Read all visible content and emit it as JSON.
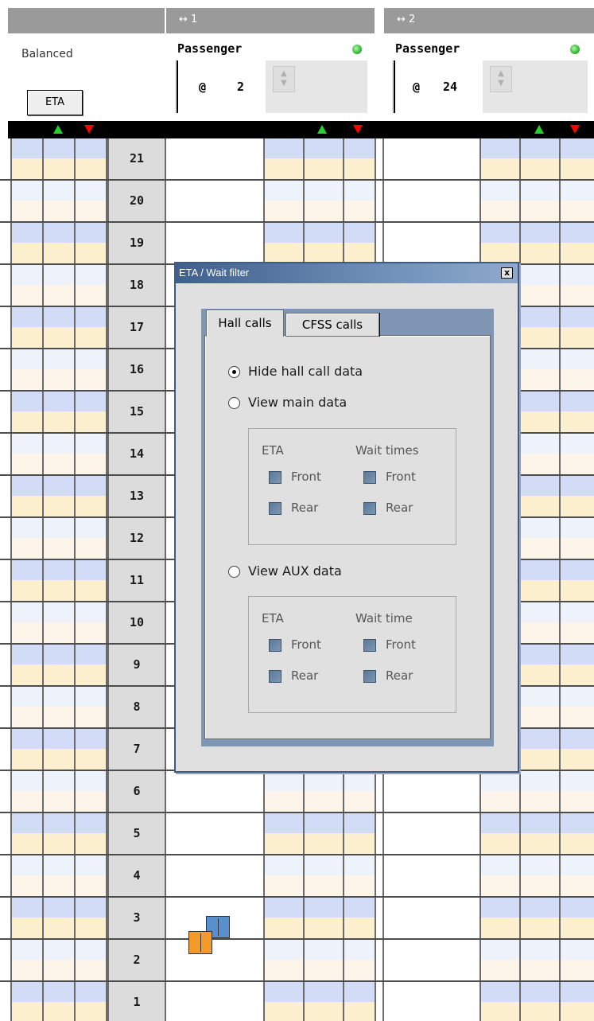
{
  "header": {
    "mode_label": "Balanced",
    "eta_button": "ETA",
    "groups": [
      {
        "label": "↔ 1",
        "car_type": "Passenger",
        "position_prefix": "@",
        "position": "2",
        "status_color": "#3bbf3b"
      },
      {
        "label": "↔ 2",
        "car_type": "Passenger",
        "position_prefix": "@",
        "position": "24",
        "status_color": "#3bbf3b"
      }
    ]
  },
  "floors": [
    "21",
    "20",
    "19",
    "18",
    "17",
    "16",
    "15",
    "14",
    "13",
    "12",
    "11",
    "10",
    "9",
    "8",
    "7",
    "6",
    "5",
    "4",
    "3",
    "2",
    "1"
  ],
  "cars_at_floor": "2",
  "dialog": {
    "title": "ETA / Wait filter",
    "close_label": "x",
    "tabs": [
      "Hall calls",
      "CFSS calls"
    ],
    "active_tab": "Hall calls",
    "options": {
      "hide": "Hide hall call data",
      "main": "View main data",
      "aux": "View AUX data"
    },
    "selected_option": "hide",
    "main_group": {
      "eta_header": "ETA",
      "wait_header": "Wait times",
      "front": "Front",
      "rear": "Rear"
    },
    "aux_group": {
      "eta_header": "ETA",
      "wait_header": "Wait time",
      "front": "Front",
      "rear": "Rear"
    }
  },
  "colors": {
    "up_arrow": "#27d12b",
    "down_arrow": "#ff0000",
    "car_orange": "#f39a2a",
    "car_blue": "#5a8fce"
  }
}
